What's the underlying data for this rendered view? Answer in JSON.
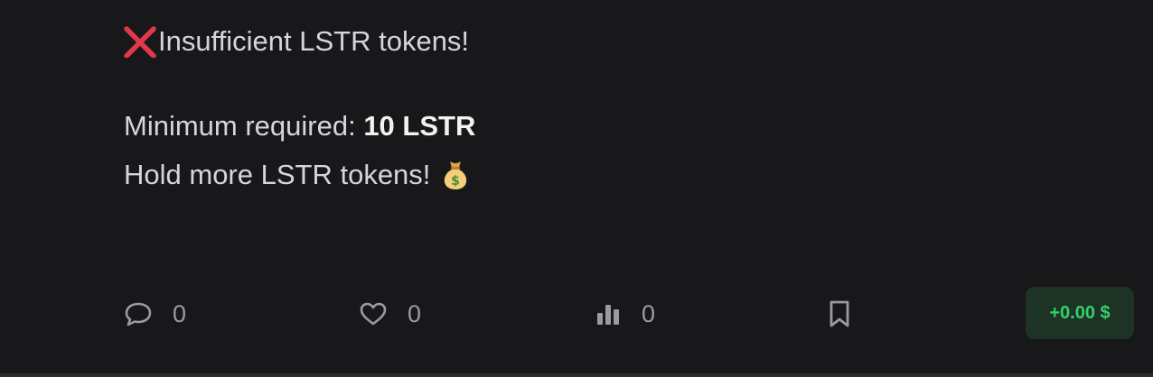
{
  "message": {
    "error_text": "Insufficient LSTR tokens!",
    "min_label": "Minimum required: ",
    "min_value": "10 LSTR",
    "hint_text": "Hold more LSTR tokens!"
  },
  "actions": {
    "comments_count": "0",
    "likes_count": "0",
    "views_count": "0"
  },
  "earnings": {
    "label": "+0.00 $"
  },
  "colors": {
    "background": "#18181b",
    "error_red": "#e0394a",
    "earnings_green": "#35d06a",
    "earnings_bg": "#1d3325"
  },
  "icons": [
    "cross-icon",
    "money-bag-icon",
    "comment-icon",
    "heart-icon",
    "bar-chart-icon",
    "bookmark-icon"
  ]
}
